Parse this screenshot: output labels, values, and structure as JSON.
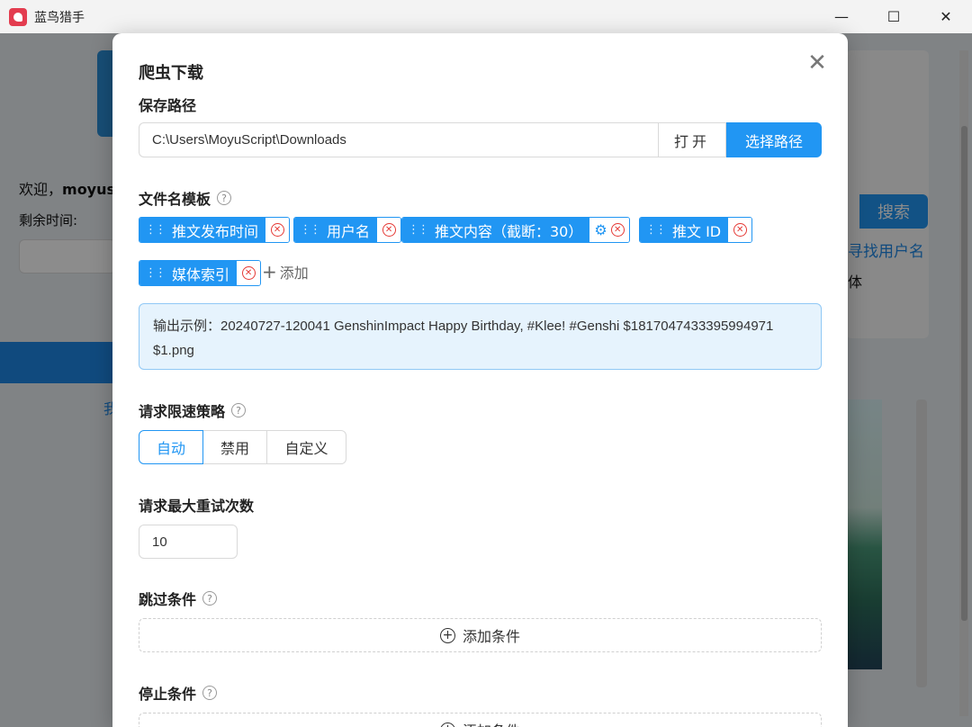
{
  "window": {
    "title": "蓝鸟猎手",
    "minimize_glyph": "—",
    "maximize_glyph": "☐",
    "close_glyph": "✕"
  },
  "background": {
    "welcome_prefix": "欢迎，",
    "welcome_user": "moyus",
    "remaining_label": "剩余时间:",
    "search_button": "搜索",
    "find_username": "寻找用户名",
    "media_fragment": "体",
    "nav_fragment": "我"
  },
  "modal": {
    "title": "爬虫下载",
    "close_glyph": "✕",
    "save_path": {
      "label": "保存路径",
      "value": "C:\\Users\\MoyuScript\\Downloads",
      "open_button": "打开",
      "choose_button": "选择路径"
    },
    "filename_template": {
      "label": "文件名模板",
      "tags": [
        {
          "label": "推文发布时间"
        },
        {
          "label": "用户名"
        },
        {
          "label": "推文内容（截断：30）",
          "has_settings": true
        },
        {
          "label": "推文 ID"
        },
        {
          "label": "媒体索引"
        }
      ],
      "add_label": "添加",
      "example": "输出示例：20240727-120041 GenshinImpact Happy Birthday, #Klee! #Genshi $1817047433395994971 $1.png"
    },
    "rate_limit": {
      "label": "请求限速策略",
      "options": [
        "自动",
        "禁用",
        "自定义"
      ],
      "selected": "自动"
    },
    "max_retries": {
      "label": "请求最大重试次数",
      "value": "10"
    },
    "skip_conditions": {
      "label": "跳过条件",
      "add_button": "添加条件"
    },
    "stop_conditions": {
      "label": "停止条件",
      "add_button": "添加条件"
    }
  },
  "colors": {
    "accent": "#2196f3",
    "danger": "#e53935",
    "example_bg": "#e6f3fd"
  }
}
